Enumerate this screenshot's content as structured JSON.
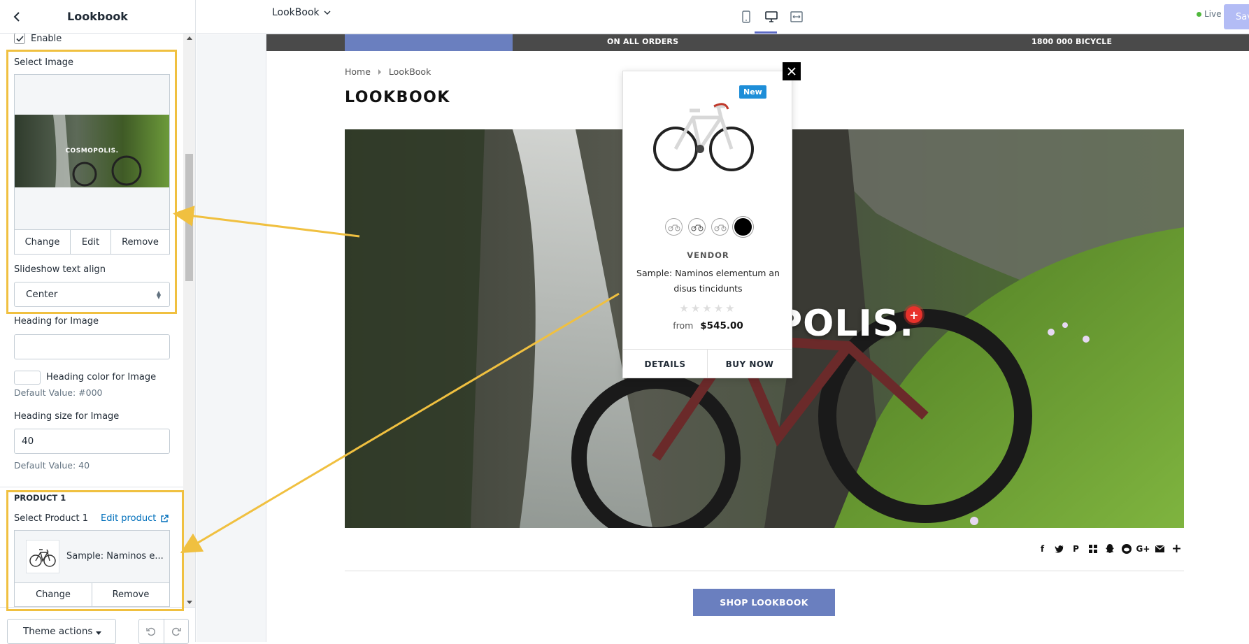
{
  "sidebar": {
    "title": "Lookbook",
    "enable_label": "Enable",
    "select_image_label": "Select Image",
    "image_caption": "COSMOPOLIS.",
    "image_buttons": [
      "Change",
      "Edit",
      "Remove"
    ],
    "text_align_label": "Slideshow text align",
    "text_align_value": "Center",
    "heading_label": "Heading for Image",
    "heading_value": "",
    "heading_color_label": "Heading color for Image",
    "heading_color_default": "Default Value: #000",
    "heading_size_label": "Heading size for Image",
    "heading_size_value": "40",
    "heading_size_default": "Default Value: 40",
    "product_section": "PRODUCT 1",
    "select_product_label": "Select Product 1",
    "edit_product_link": "Edit product",
    "product_name": "Sample: Naminos e...",
    "product_buttons": [
      "Change",
      "Remove"
    ],
    "theme_actions": "Theme actions"
  },
  "topbar": {
    "page_select": "LookBook",
    "live": "Live",
    "save": "Sav"
  },
  "preview": {
    "promo_left": "ON ALL ORDERS",
    "promo_right": "1800 000 BICYCLE",
    "breadcrumb": [
      "Home",
      "LookBook"
    ],
    "page_heading": "LOOKBOOK",
    "hero_text": "POLIS.",
    "hotspot": "+",
    "shop_button": "SHOP LOOKBOOK",
    "share_icons": [
      "facebook-icon",
      "twitter-icon",
      "pinterest-icon",
      "grid-icon",
      "snapchat-icon",
      "reddit-icon",
      "google-plus-icon",
      "email-icon",
      "plus-icon"
    ]
  },
  "popup": {
    "badge": "New",
    "vendor": "VENDOR",
    "title": "Sample: Naminos elementum an disus tincidunts",
    "rating": 0,
    "price_prefix": "from",
    "price": "$545.00",
    "details": "DETAILS",
    "buy_now": "BUY NOW"
  },
  "colors": {
    "highlight": "#f0c040",
    "button_blue": "#6a7fbf",
    "hotspot_red": "#e8322b",
    "new_badge": "#1e8ed8"
  }
}
